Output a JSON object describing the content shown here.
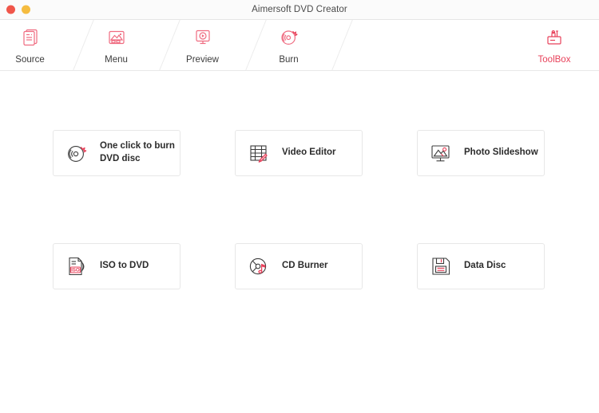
{
  "window": {
    "title": "Aimersoft DVD Creator",
    "controls": [
      {
        "name": "close",
        "color": "#f0564a"
      },
      {
        "name": "minimize",
        "color": "#f5bc40"
      }
    ]
  },
  "nav": {
    "steps": [
      {
        "label": "Source",
        "icon": "document-stack-icon"
      },
      {
        "label": "Menu",
        "icon": "picture-menu-icon"
      },
      {
        "label": "Preview",
        "icon": "monitor-play-icon"
      },
      {
        "label": "Burn",
        "icon": "disc-burn-icon"
      }
    ],
    "toolbox": {
      "label": "ToolBox",
      "icon": "toolbox-icon",
      "color": "#e8415a"
    }
  },
  "tools": [
    {
      "label": "One click to burn DVD disc",
      "icon": "disc-burn-icon"
    },
    {
      "label": "Video Editor",
      "icon": "film-pencil-icon"
    },
    {
      "label": "Photo Slideshow",
      "icon": "photo-monitor-icon"
    },
    {
      "label": "ISO to DVD",
      "icon": "iso-file-icon"
    },
    {
      "label": "CD Burner",
      "icon": "cd-music-icon"
    },
    {
      "label": "Data Disc",
      "icon": "floppy-disk-icon"
    }
  ],
  "colors": {
    "accent": "#e8415a",
    "accent_soft": "#ef6b80",
    "dark": "#3c3c3c",
    "card_border": "#e7e7e7"
  }
}
